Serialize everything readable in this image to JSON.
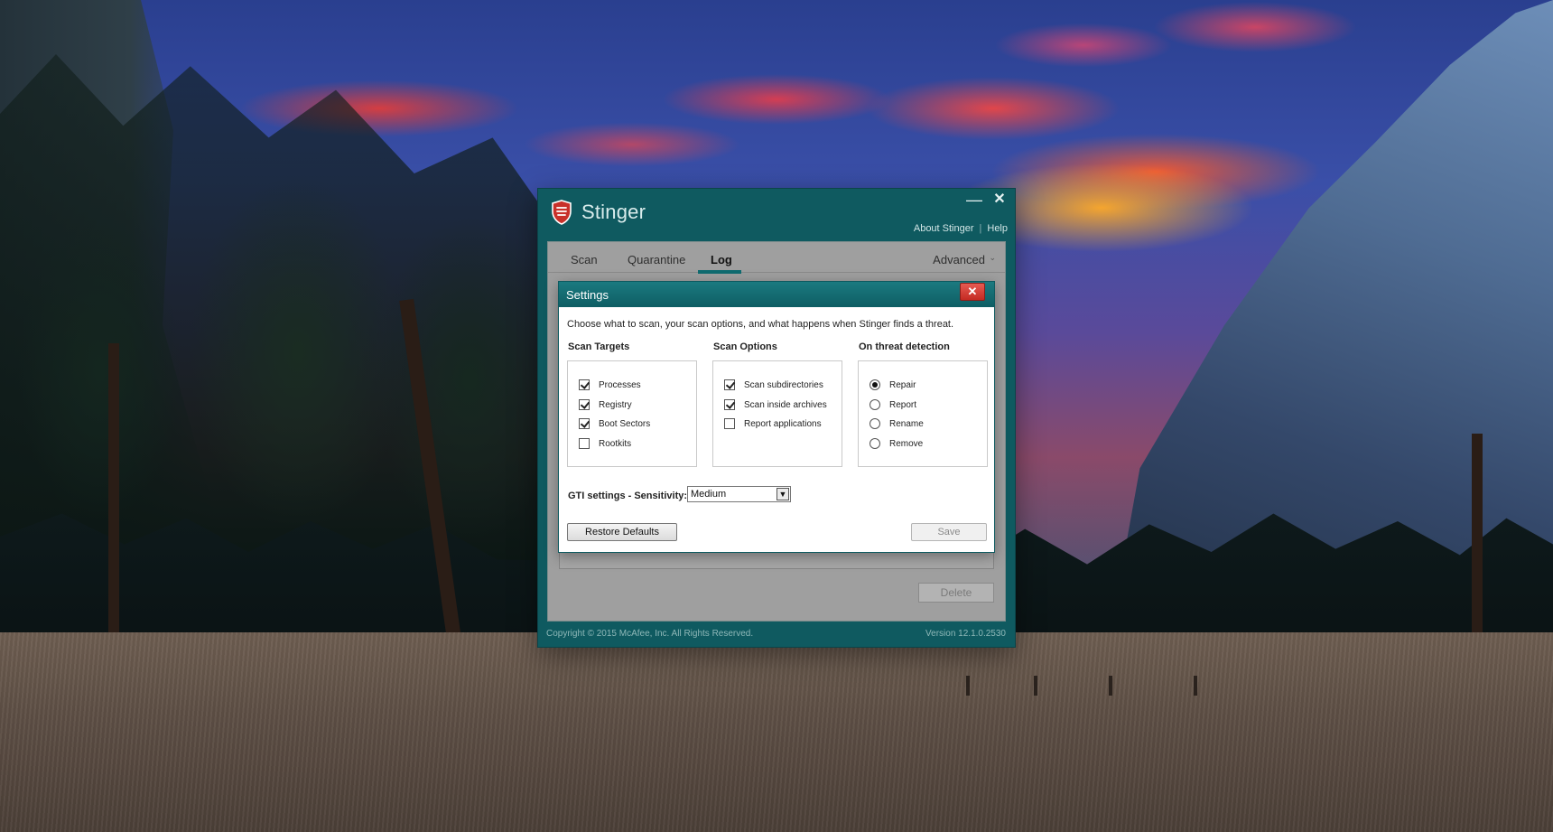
{
  "window": {
    "title": "Stinger",
    "minimize_glyph": "—",
    "close_glyph": "✕",
    "top_links": {
      "about": "About Stinger",
      "separator": "|",
      "help": "Help"
    },
    "tabs": [
      {
        "label": "Scan",
        "active": false
      },
      {
        "label": "Quarantine",
        "active": false
      },
      {
        "label": "Log",
        "active": true
      },
      {
        "label": "Advanced",
        "active": false
      }
    ],
    "advanced_chevron": "⌄",
    "delete_label": "Delete",
    "footer": {
      "copyright": "Copyright © 2015 McAfee, Inc. All Rights Reserved.",
      "version": "Version 12.1.0.2530"
    }
  },
  "settings": {
    "title": "Settings",
    "close_glyph": "✕",
    "description": "Choose what to scan, your scan options, and what happens when Stinger finds a threat.",
    "scan_targets": {
      "label": "Scan Targets",
      "items": [
        {
          "label": "Processes",
          "checked": true
        },
        {
          "label": "Registry",
          "checked": true
        },
        {
          "label": "Boot Sectors",
          "checked": true
        },
        {
          "label": "Rootkits",
          "checked": false
        }
      ]
    },
    "scan_options": {
      "label": "Scan Options",
      "items": [
        {
          "label": "Scan subdirectories",
          "checked": true
        },
        {
          "label": "Scan inside archives",
          "checked": true
        },
        {
          "label": "Report applications",
          "checked": false
        }
      ]
    },
    "threat_detection": {
      "label": "On threat detection",
      "items": [
        {
          "label": "Repair",
          "selected": true
        },
        {
          "label": "Report",
          "selected": false
        },
        {
          "label": "Rename",
          "selected": false
        },
        {
          "label": "Remove",
          "selected": false
        }
      ]
    },
    "gti": {
      "label": "GTI settings - Sensitivity:",
      "value": "Medium",
      "arrow_glyph": "▼"
    },
    "restore_label": "Restore Defaults",
    "save_label": "Save"
  },
  "colors": {
    "window_teal": "#0f5a60",
    "dialog_close_red": "#c42a22",
    "shield_red": "#c8302a"
  },
  "icons": {
    "brand": "shield-icon",
    "minimize": "minimize-icon",
    "close": "close-icon",
    "dropdown": "chevron-down-icon"
  }
}
